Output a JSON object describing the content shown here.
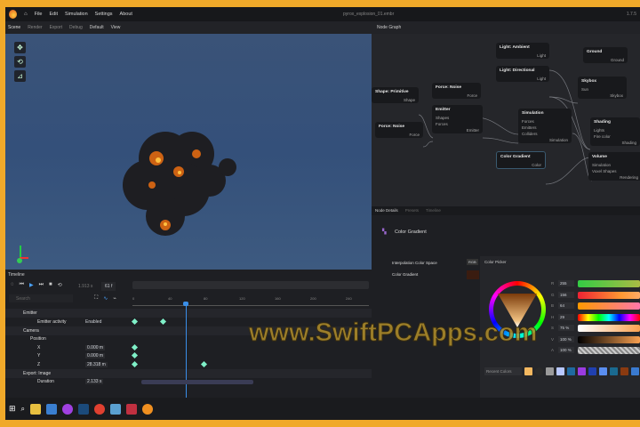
{
  "titlebar": {
    "menu": [
      "File",
      "Edit",
      "Simulation",
      "Settings",
      "About"
    ],
    "filename": "pyrox_explosion_01.embr",
    "version": "1.7.5"
  },
  "toolbar": {
    "tabs": [
      "Scene",
      "Render",
      "Export",
      "Debug"
    ],
    "layout": "Default",
    "view": "View",
    "node_graph_title": "Node Graph"
  },
  "timeline": {
    "title": "Timeline",
    "frame": "1.913 s",
    "fps": "61 f",
    "search_placeholder": "Search",
    "ruler": [
      "0",
      "40",
      "80",
      "120",
      "160",
      "200",
      "240"
    ],
    "rows": [
      {
        "label": "Emitter",
        "type": "group"
      },
      {
        "label": "Emitter activity",
        "value": "Enabled"
      },
      {
        "label": "Camera",
        "type": "group"
      },
      {
        "label": "Position",
        "type": "sub"
      },
      {
        "label": "X",
        "value": "0.000 m"
      },
      {
        "label": "Y",
        "value": "0.000 m"
      },
      {
        "label": "Z",
        "value": "28.318 m"
      },
      {
        "label": "Export: Image",
        "type": "group"
      },
      {
        "label": "Duration",
        "value": "2.133 s"
      }
    ]
  },
  "nodes": [
    {
      "title": "Light: Ambient",
      "port": "Light"
    },
    {
      "title": "Light: Directional",
      "port": "Light"
    },
    {
      "title": "Ground",
      "port": "Ground"
    },
    {
      "title": "Skybox",
      "in": "Sun",
      "port": "Skybox"
    },
    {
      "title": "Shape: Primitive",
      "port": "Shape"
    },
    {
      "title": "Force: Noise",
      "port": "Force"
    },
    {
      "title": "Emitter",
      "in": "Shapes",
      "in2": "Forces",
      "port": "Emitter"
    },
    {
      "title": "Force: Noise",
      "port": "Force"
    },
    {
      "title": "Simulation",
      "in": "Forces",
      "in2": "Emitters",
      "in3": "Colliders",
      "port": "Simulation"
    },
    {
      "title": "Shading",
      "in": "Lights",
      "in2": "Fire color",
      "port": "Shading"
    },
    {
      "title": "Color Gradient",
      "port": "Color"
    },
    {
      "title": "Volume",
      "in": "Simulation",
      "in2": "Voxel Shapes",
      "port": "Rendering"
    }
  ],
  "details": {
    "tabs": [
      "Node Details",
      "Presets",
      "Timeline"
    ],
    "node_title": "Color Gradient",
    "interp_label": "Interpolation Color Space",
    "interp_value": "RGB",
    "gradient_label": "Color Gradient",
    "picker": {
      "title": "Color Picker",
      "fields": [
        {
          "label": "R",
          "value": "255"
        },
        {
          "label": "G",
          "value": "156"
        },
        {
          "label": "B",
          "value": "64"
        },
        {
          "label": "H",
          "value": "29"
        },
        {
          "label": "S",
          "value": "75 %"
        },
        {
          "label": "V",
          "value": "100 %"
        },
        {
          "label": "A",
          "value": "100 %"
        }
      ],
      "recent_label": "Recent Colors",
      "current_color": "#ff9c40"
    }
  },
  "swatches": [
    "#f4b860",
    "#2a2a2a",
    "#9a9a9a",
    "#b8c8ff",
    "#1f6aa0",
    "#9b3be0",
    "#2040b0",
    "#5a8ef0",
    "#1a6a90",
    "#8a3a10",
    "#3a7ad0"
  ],
  "watermark": "www.SwiftPCApps.com"
}
